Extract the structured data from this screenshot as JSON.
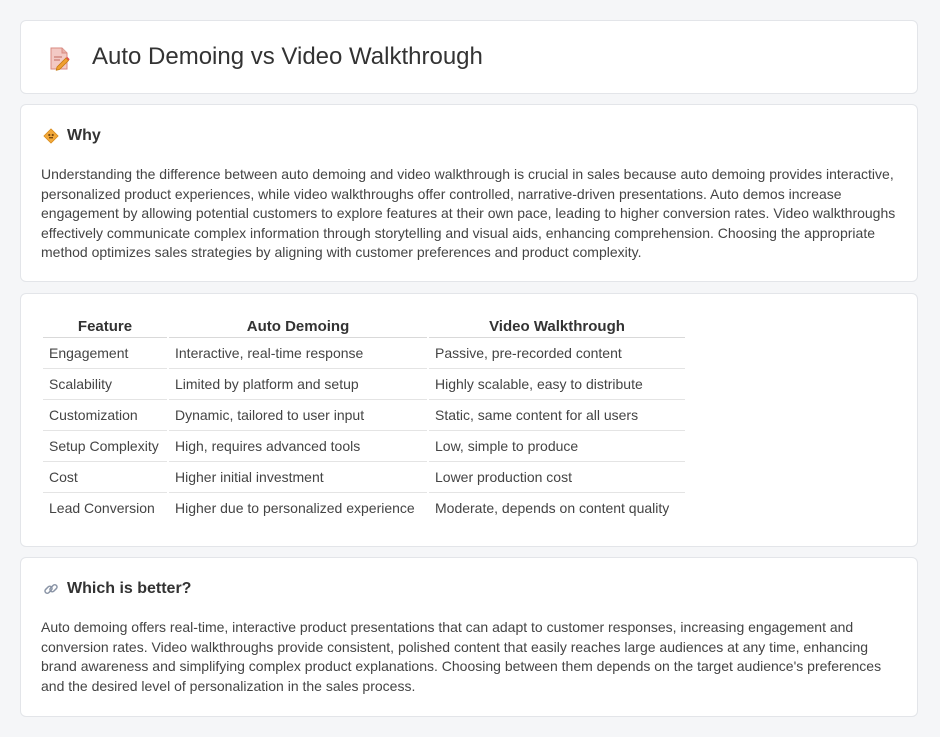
{
  "header": {
    "title": "Auto Demoing vs Video Walkthrough",
    "icon": "document-pencil-icon"
  },
  "why": {
    "heading": "Why",
    "icon": "sign-icon",
    "text": "Understanding the difference between auto demoing and video walkthrough is crucial in sales because auto demoing provides interactive, personalized product experiences, while video walkthroughs offer controlled, narrative-driven presentations. Auto demos increase engagement by allowing potential customers to explore features at their own pace, leading to higher conversion rates. Video walkthroughs effectively communicate complex information through storytelling and visual aids, enhancing comprehension. Choosing the appropriate method optimizes sales strategies by aligning with customer preferences and product complexity."
  },
  "table": {
    "headers": [
      "Feature",
      "Auto Demoing",
      "Video Walkthrough"
    ],
    "rows": [
      [
        "Engagement",
        "Interactive, real-time response",
        "Passive, pre-recorded content"
      ],
      [
        "Scalability",
        "Limited by platform and setup",
        "Highly scalable, easy to distribute"
      ],
      [
        "Customization",
        "Dynamic, tailored to user input",
        "Static, same content for all users"
      ],
      [
        "Setup Complexity",
        "High, requires advanced tools",
        "Low, simple to produce"
      ],
      [
        "Cost",
        "Higher initial investment",
        "Lower production cost"
      ],
      [
        "Lead Conversion",
        "Higher due to personalized experience",
        "Moderate, depends on content quality"
      ]
    ]
  },
  "better": {
    "heading": "Which is better?",
    "icon": "link-icon",
    "text": "Auto demoing offers real-time, interactive product presentations that can adapt to customer responses, increasing engagement and conversion rates. Video walkthroughs provide consistent, polished content that easily reaches large audiences at any time, enhancing brand awareness and simplifying complex product explanations. Choosing between them depends on the target audience's preferences and the desired level of personalization in the sales process."
  }
}
